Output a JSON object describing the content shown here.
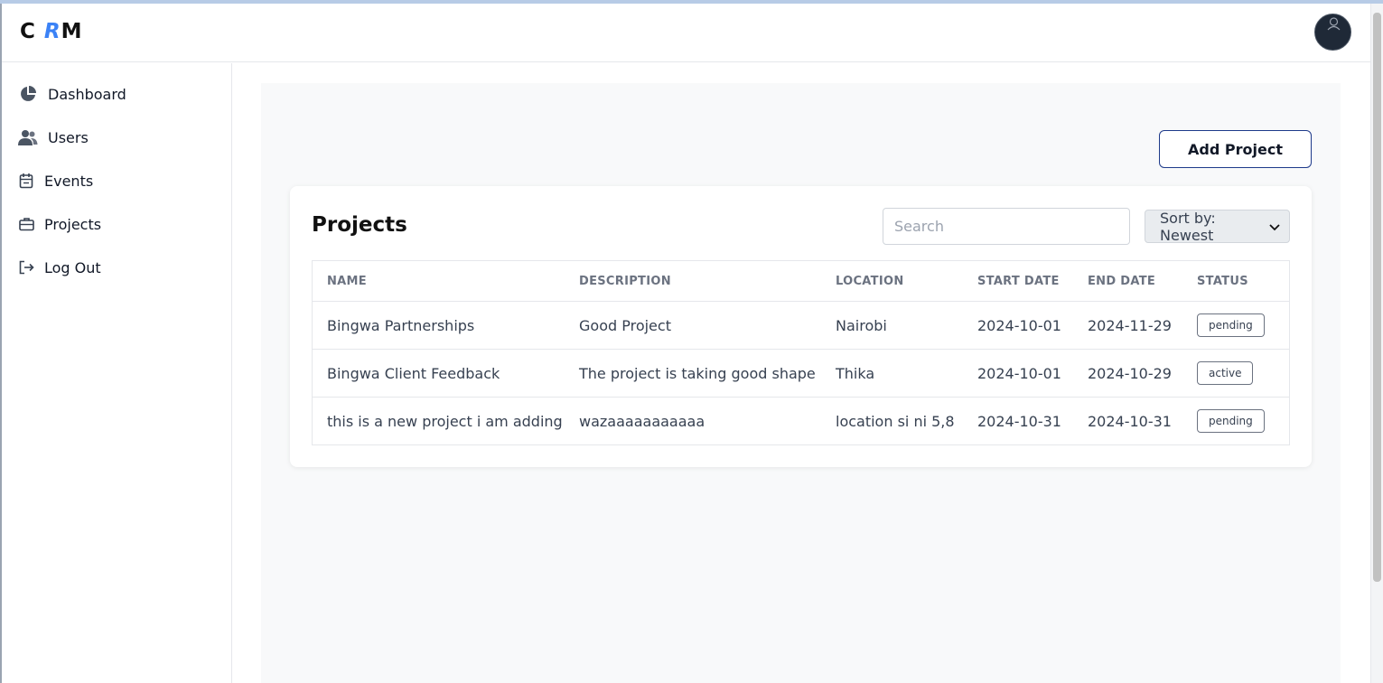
{
  "header": {
    "logo": {
      "c": "C",
      "r": "R",
      "m": "M"
    },
    "avatar_icon": "user-avatar-icon"
  },
  "sidebar": {
    "items": [
      {
        "label": "Dashboard",
        "icon": "pie-chart-icon"
      },
      {
        "label": "Users",
        "icon": "users-icon"
      },
      {
        "label": "Events",
        "icon": "calendar-icon"
      },
      {
        "label": "Projects",
        "icon": "briefcase-icon"
      },
      {
        "label": "Log Out",
        "icon": "logout-icon"
      }
    ]
  },
  "main": {
    "add_button": "Add Project",
    "card_title": "Projects",
    "search_placeholder": "Search",
    "sort_label": "Sort by: Newest",
    "columns": [
      "NAME",
      "DESCRIPTION",
      "LOCATION",
      "START DATE",
      "END DATE",
      "STATUS"
    ],
    "rows": [
      {
        "name": "Bingwa Partnerships",
        "description": "Good Project",
        "location": "Nairobi",
        "start": "2024-10-01",
        "end": "2024-11-29",
        "status": "pending"
      },
      {
        "name": "Bingwa Client Feedback",
        "description": "The project is taking good shape",
        "location": "Thika",
        "start": "2024-10-01",
        "end": "2024-10-29",
        "status": "active"
      },
      {
        "name": "this is a new project i am adding",
        "description": "wazaaaaaaaaaaa",
        "location": "location si ni 5,8",
        "start": "2024-10-31",
        "end": "2024-10-31",
        "status": "pending"
      }
    ]
  },
  "colors": {
    "accent": "#3b82f6",
    "border_button": "#1e3a8a",
    "main_bg": "#f8f9fa"
  }
}
